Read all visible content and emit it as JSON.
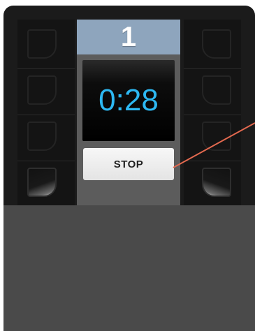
{
  "header": {
    "number": "1"
  },
  "timer": {
    "value": "0:28"
  },
  "controls": {
    "stop_label": "STOP"
  },
  "colors": {
    "header_bg": "#8ea5bd",
    "timer_digits": "#2db8f2",
    "device_bg": "#1b1b1b",
    "annotation_line": "#e3694f"
  },
  "left_slots": [
    {
      "state": "inactive"
    },
    {
      "state": "inactive"
    },
    {
      "state": "inactive"
    },
    {
      "state": "active"
    }
  ],
  "right_slots": [
    {
      "state": "inactive"
    },
    {
      "state": "inactive"
    },
    {
      "state": "inactive"
    },
    {
      "state": "active"
    }
  ]
}
